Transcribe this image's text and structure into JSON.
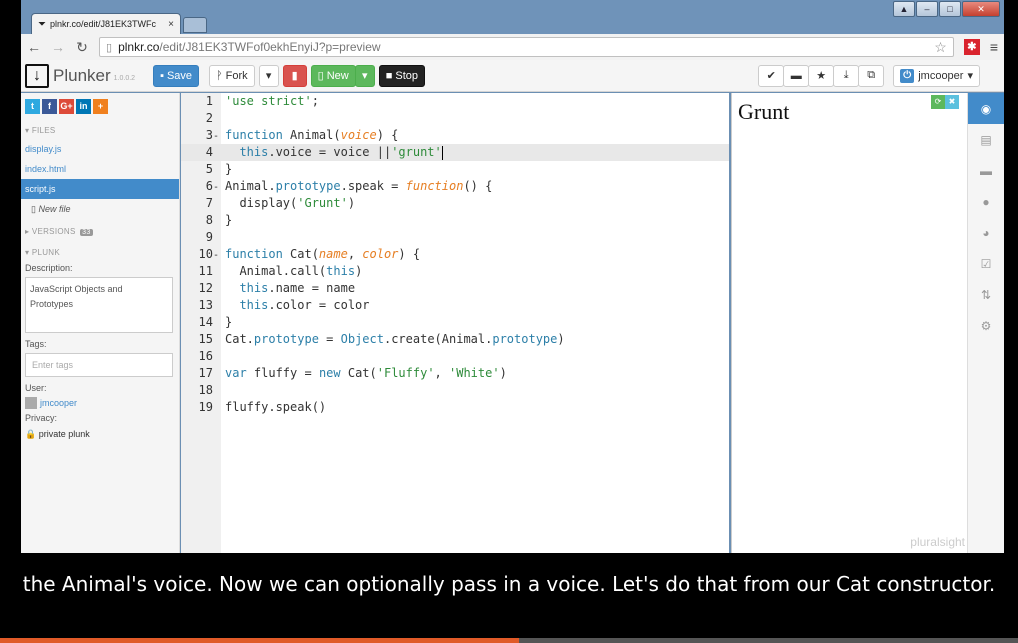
{
  "browser": {
    "tab_title": "plnkr.co/edit/J81EK3TWFc",
    "tab_close": "×",
    "url_host": "plnkr.co",
    "url_path": "/edit/J81EK3TWFof0ekhEnyiJ?p=preview"
  },
  "toolbar": {
    "logo_text": "Plunker",
    "logo_version": "1.0.0.2",
    "save_label": "Save",
    "fork_label": "Fork",
    "new_label": "New",
    "stop_label": "Stop",
    "user_label": "jmcooper"
  },
  "sidebar": {
    "files_header": "▾ FILES",
    "files": [
      "display.js",
      "index.html",
      "script.js"
    ],
    "active_file": "script.js",
    "new_file_label": "New file",
    "versions_header": "▸ VERSIONS",
    "versions_count": "33",
    "plunk_header": "▾ PLUNK",
    "description_label": "Description:",
    "description_value": "JavaScript Objects and Prototypes",
    "tags_label": "Tags:",
    "tags_placeholder": "Enter tags",
    "user_label": "User:",
    "user_name": "jmcooper",
    "privacy_label": "Privacy:",
    "privacy_value": "private plunk"
  },
  "editor": {
    "active_line": 4,
    "lines": [
      "'use strict';",
      "",
      "function Animal(voice) {",
      "  this.voice = voice ||'grunt'",
      "}",
      "Animal.prototype.speak = function() {",
      "  display('Grunt')",
      "}",
      "",
      "function Cat(name, color) {",
      "  Animal.call(this)",
      "  this.name = name",
      "  this.color = color",
      "}",
      "Cat.prototype = Object.create(Animal.prototype)",
      "",
      "var fluffy = new Cat('Fluffy', 'White')",
      "",
      "fluffy.speak()"
    ]
  },
  "preview": {
    "output_text": "Grunt",
    "watermark": "pluralsight"
  },
  "caption": "the Animal's voice. Now we can optionally pass in a voice. Let's do that from our Cat constructor.",
  "video_progress": 0.51,
  "colors": {
    "accent": "#428bca",
    "save": "#428bca",
    "new": "#5cb85c",
    "delete": "#d9534f",
    "progress": "#e05a28"
  }
}
